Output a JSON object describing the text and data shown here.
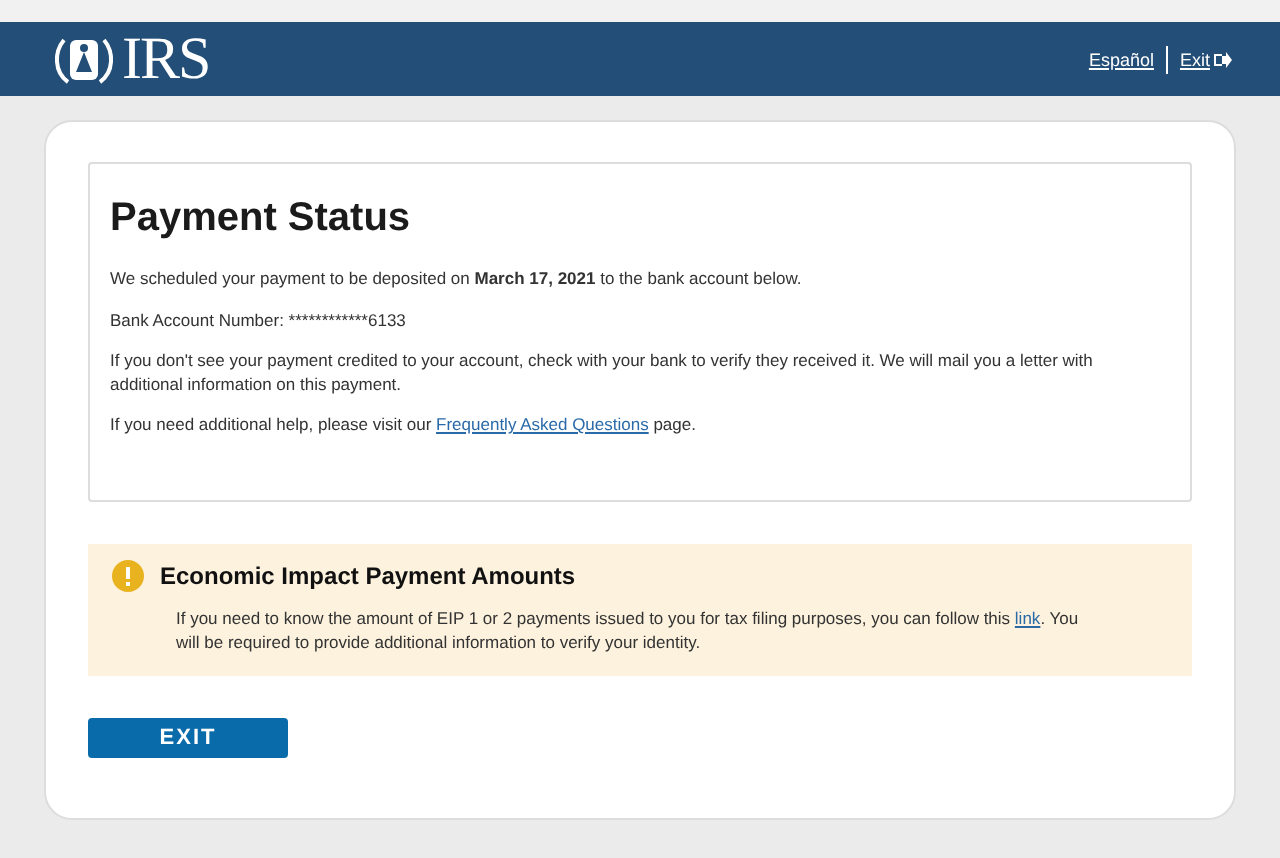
{
  "header": {
    "logo_text": "IRS",
    "links": [
      {
        "label": "Español",
        "kind": "plain"
      },
      {
        "label": "Exit",
        "kind": "exit"
      }
    ]
  },
  "status": {
    "title": "Payment Status",
    "paragraphs": [
      {
        "text": "We scheduled your payment to be deposited on ",
        "bold": "March 17, 2021",
        "after": " to the bank account below."
      },
      {
        "text": "Bank Account Number: ************6133"
      },
      {
        "text": "If you don't see your payment credited to your account, check with your bank to verify they received it. We will mail you a letter with additional information on this payment."
      },
      {
        "text": "If you need additional help, please visit our ",
        "link": "Frequently Asked Questions",
        "after": " page."
      }
    ]
  },
  "alert": {
    "title": "Economic Impact Payment Amounts",
    "text": "If you need to know the amount of EIP 1 or 2 payments issued to you for tax filing purposes, you can follow this ",
    "link": "link",
    "after": ". You will be required to provide additional information to verify your identity."
  },
  "exit_button": "EXIT"
}
